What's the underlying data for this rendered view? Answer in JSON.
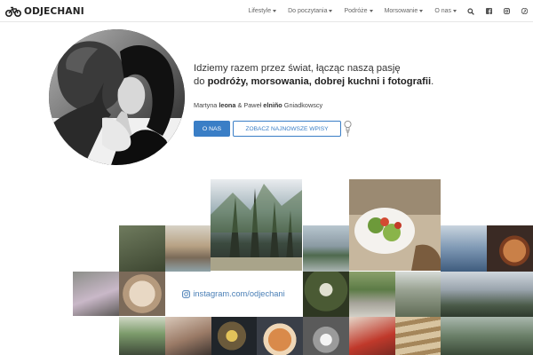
{
  "brand": {
    "name": "ODJECHANI",
    "icon": "bike-logo-icon"
  },
  "nav": {
    "items": [
      {
        "label": "Lifestyle",
        "has_caret": true
      },
      {
        "label": "Do poczytania",
        "has_caret": true
      },
      {
        "label": "Podróże",
        "has_caret": true
      },
      {
        "label": "Morsowanie",
        "has_caret": true
      },
      {
        "label": "O nas",
        "has_caret": true
      }
    ],
    "icons": [
      "search-icon",
      "facebook-icon",
      "instagram-icon",
      "pinterest-icon"
    ]
  },
  "hero": {
    "tagline_line1": "Idziemy razem przez świat, łącząc naszą pasję",
    "tagline_prefix": "do ",
    "tagline_bold": "podróży, morsowania, dobrej kuchni i fotografii",
    "tagline_suffix": ".",
    "authors": {
      "first_name": "Martyna ",
      "first_nick": "leona",
      "joiner": " & Paweł ",
      "second_nick": "elniño",
      "surname": " Gniadkowscy"
    },
    "about_button": "O NAS",
    "latest_button": "ZOBACZ NAJNOWSZE WPISY"
  },
  "instagram": {
    "link_text": "instagram.com/odjechani",
    "icon": "instagram-icon"
  },
  "colors": {
    "accent": "#3a7ec6",
    "link": "#4a7fb6",
    "text": "#333333",
    "nav_text": "#666666"
  }
}
